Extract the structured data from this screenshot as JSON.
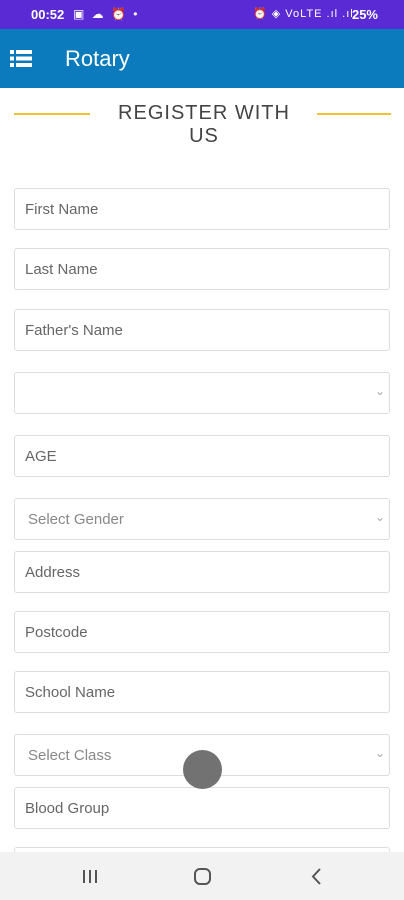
{
  "status_bar": {
    "time": "00:52",
    "notification_icons": "▣ ☁ ⏰ •",
    "system_icons": "⏰ ◈ VoLTE .ıl .ıl",
    "battery": "25%"
  },
  "app_bar": {
    "menu_icon": "list-menu-icon",
    "title": "Rotary"
  },
  "header": {
    "title": "REGISTER WITH US",
    "accent_color": "#f1c232"
  },
  "form": {
    "first_name_placeholder": "First Name",
    "last_name_placeholder": "Last Name",
    "fathers_name_placeholder": "Father's Name",
    "unlabeled_select_value": "",
    "age_placeholder": "AGE",
    "gender_select_value": "Select Gender",
    "address_placeholder": "Address",
    "postcode_placeholder": "Postcode",
    "school_name_placeholder": "School Name",
    "class_select_value": "Select Class",
    "blood_group_placeholder": "Blood Group"
  },
  "colors": {
    "status_bar": "#5a2bd4",
    "app_bar": "#0b7bbd"
  }
}
